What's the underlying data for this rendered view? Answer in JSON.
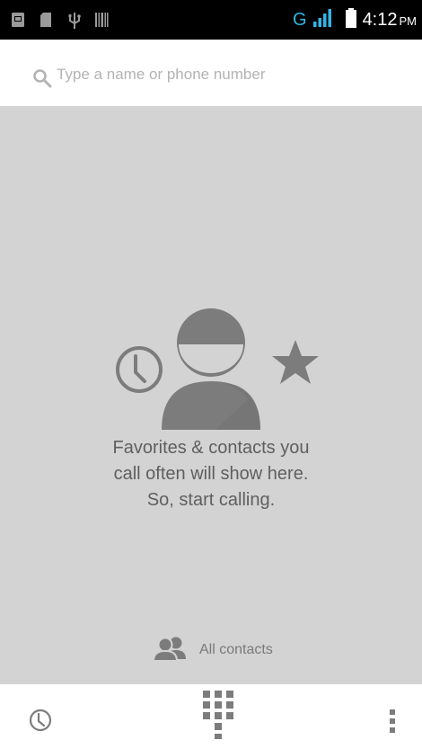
{
  "status_bar": {
    "left_icons": [
      "sim-card-icon",
      "sd-card-icon",
      "usb-icon",
      "barcode-icon"
    ],
    "network_type": "G",
    "time": "4:12",
    "ampm": "PM",
    "colors": {
      "network": "#33b5e5",
      "background": "#000000"
    }
  },
  "search": {
    "icon": "search-icon",
    "placeholder": "Type a name or phone number"
  },
  "empty_state": {
    "icons": [
      "recent-clock-icon",
      "contact-avatar-icon",
      "star-icon"
    ],
    "lines": [
      "Favorites & contacts you",
      "call often will show here.",
      "So, start calling."
    ]
  },
  "all_contacts": {
    "icon": "contacts-group-icon",
    "label": "All contacts"
  },
  "bottom_bar": {
    "icons": [
      "call-history-icon",
      "dialpad-icon",
      "overflow-menu-icon"
    ]
  },
  "colors": {
    "content_background": "#d3d3d3",
    "illustration_gray": "#7c7c7c"
  }
}
